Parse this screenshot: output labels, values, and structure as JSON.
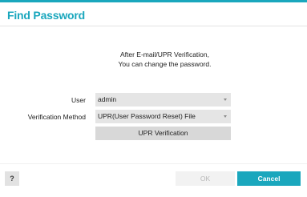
{
  "dialog": {
    "title": "Find Password",
    "accent_color": "#1aa7bd"
  },
  "message": {
    "line1": "After E-mail/UPR Verification,",
    "line2": "You can change the password."
  },
  "form": {
    "user": {
      "label": "User",
      "value": "admin"
    },
    "verification_method": {
      "label": "Verification Method",
      "value": "UPR(User Password Reset) File"
    },
    "verify_button_label": "UPR Verification"
  },
  "footer": {
    "help_label": "?",
    "ok_label": "OK",
    "ok_enabled": false,
    "cancel_label": "Cancel"
  }
}
